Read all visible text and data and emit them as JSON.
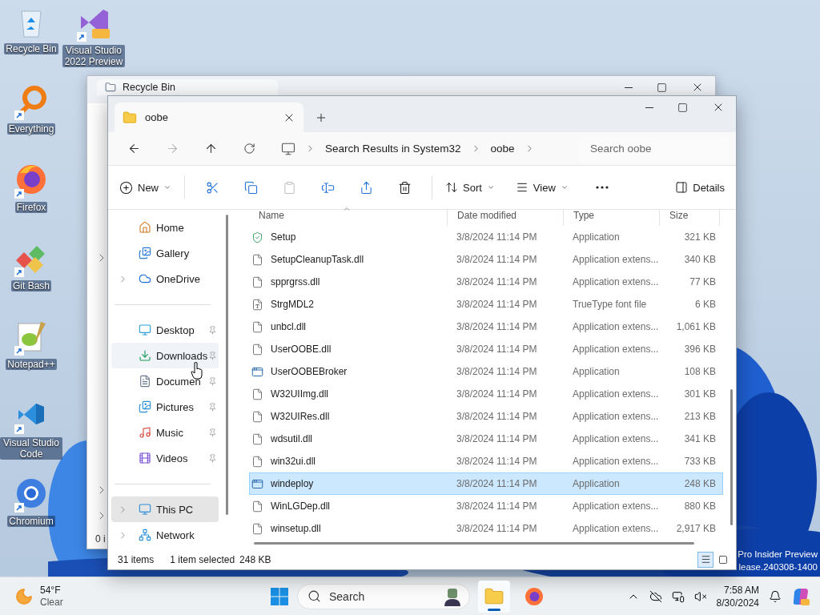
{
  "desktop": {
    "icons": [
      {
        "label": "Recycle Bin",
        "kind": "recycle",
        "shortcut": false
      },
      {
        "label": "Visual Studio 2022 Preview",
        "kind": "vs",
        "shortcut": true
      },
      {
        "label": "Everything",
        "kind": "everything",
        "shortcut": true
      },
      {
        "label": "Firefox",
        "kind": "firefox",
        "shortcut": true
      },
      {
        "label": "Git Bash",
        "kind": "git",
        "shortcut": true
      },
      {
        "label": "Notepad++",
        "kind": "notepad",
        "shortcut": true
      },
      {
        "label": "Visual Studio Code",
        "kind": "vscode",
        "shortcut": true
      },
      {
        "label": "Chromium",
        "kind": "chromium",
        "shortcut": true
      }
    ],
    "watermark": [
      "Pro Insider Preview",
      "lease.240308-1400"
    ]
  },
  "background_window": {
    "tab_title": "Recycle Bin",
    "status": "0 i"
  },
  "window": {
    "tabs": [
      {
        "title": "oobe",
        "selected": true
      }
    ],
    "address": {
      "crumbs": [
        "Search Results in System32",
        "oobe"
      ]
    },
    "search": {
      "placeholder": "Search oobe"
    },
    "toolbar": {
      "new": "New",
      "sort": "Sort",
      "view": "View",
      "details": "Details"
    },
    "nav": [
      {
        "kind": "item",
        "label": "Home",
        "expandable": false,
        "pinned": false,
        "selected": false,
        "hovered": false
      },
      {
        "kind": "item",
        "label": "Gallery",
        "expandable": false,
        "pinned": false,
        "selected": false,
        "hovered": false
      },
      {
        "kind": "item",
        "label": "OneDrive",
        "expandable": true,
        "pinned": false,
        "selected": false,
        "hovered": false
      },
      {
        "kind": "divider"
      },
      {
        "kind": "item",
        "label": "Desktop",
        "expandable": false,
        "pinned": true,
        "selected": false,
        "hovered": false
      },
      {
        "kind": "item",
        "label": "Downloads",
        "expandable": false,
        "pinned": true,
        "selected": false,
        "hovered": true
      },
      {
        "kind": "item",
        "label": "Documen",
        "expandable": false,
        "pinned": true,
        "selected": false,
        "hovered": false
      },
      {
        "kind": "item",
        "label": "Pictures",
        "expandable": false,
        "pinned": true,
        "selected": false,
        "hovered": false
      },
      {
        "kind": "item",
        "label": "Music",
        "expandable": false,
        "pinned": true,
        "selected": false,
        "hovered": false
      },
      {
        "kind": "item",
        "label": "Videos",
        "expandable": false,
        "pinned": true,
        "selected": false,
        "hovered": false
      },
      {
        "kind": "divider"
      },
      {
        "kind": "item",
        "label": "This PC",
        "expandable": true,
        "pinned": false,
        "selected": true,
        "hovered": false
      },
      {
        "kind": "item",
        "label": "Network",
        "expandable": true,
        "pinned": false,
        "selected": false,
        "hovered": false
      }
    ],
    "columns": [
      {
        "label": "Name",
        "sorted": true
      },
      {
        "label": "Date modified",
        "sorted": false
      },
      {
        "label": "Type",
        "sorted": false
      },
      {
        "label": "Size",
        "sorted": false
      }
    ],
    "rows": [
      {
        "kind": "setup",
        "name": "Setup",
        "date": "3/8/2024 11:14 PM",
        "type": "Application",
        "size": "321 KB",
        "selected": false
      },
      {
        "kind": "dll",
        "name": "SetupCleanupTask.dll",
        "date": "3/8/2024 11:14 PM",
        "type": "Application extens...",
        "size": "340 KB",
        "selected": false
      },
      {
        "kind": "dll",
        "name": "spprgrss.dll",
        "date": "3/8/2024 11:14 PM",
        "type": "Application extens...",
        "size": "77 KB",
        "selected": false
      },
      {
        "kind": "font",
        "name": "StrgMDL2",
        "date": "3/8/2024 11:14 PM",
        "type": "TrueType font file",
        "size": "6 KB",
        "selected": false
      },
      {
        "kind": "dll",
        "name": "unbcl.dll",
        "date": "3/8/2024 11:14 PM",
        "type": "Application extens...",
        "size": "1,061 KB",
        "selected": false
      },
      {
        "kind": "dll",
        "name": "UserOOBE.dll",
        "date": "3/8/2024 11:14 PM",
        "type": "Application extens...",
        "size": "396 KB",
        "selected": false
      },
      {
        "kind": "exe",
        "name": "UserOOBEBroker",
        "date": "3/8/2024 11:14 PM",
        "type": "Application",
        "size": "108 KB",
        "selected": false
      },
      {
        "kind": "dll",
        "name": "W32UIImg.dll",
        "date": "3/8/2024 11:14 PM",
        "type": "Application extens...",
        "size": "301 KB",
        "selected": false
      },
      {
        "kind": "dll",
        "name": "W32UIRes.dll",
        "date": "3/8/2024 11:14 PM",
        "type": "Application extens...",
        "size": "213 KB",
        "selected": false
      },
      {
        "kind": "dll",
        "name": "wdsutil.dll",
        "date": "3/8/2024 11:14 PM",
        "type": "Application extens...",
        "size": "341 KB",
        "selected": false
      },
      {
        "kind": "dll",
        "name": "win32ui.dll",
        "date": "3/8/2024 11:14 PM",
        "type": "Application extens...",
        "size": "733 KB",
        "selected": false
      },
      {
        "kind": "exe",
        "name": "windeploy",
        "date": "3/8/2024 11:14 PM",
        "type": "Application",
        "size": "248 KB",
        "selected": true
      },
      {
        "kind": "dll",
        "name": "WinLGDep.dll",
        "date": "3/8/2024 11:14 PM",
        "type": "Application extens...",
        "size": "880 KB",
        "selected": false
      },
      {
        "kind": "dll",
        "name": "winsetup.dll",
        "date": "3/8/2024 11:14 PM",
        "type": "Application extens...",
        "size": "2,917 KB",
        "selected": false
      }
    ],
    "status": {
      "count": "31 items",
      "selection": "1 item selected",
      "size": "248 KB"
    },
    "views": [
      {
        "kind": "details",
        "selected": true
      },
      {
        "kind": "tiles",
        "selected": false
      }
    ]
  },
  "taskbar": {
    "weather": {
      "temp": "54°F",
      "condition": "Clear"
    },
    "search": "Search",
    "apps": [
      {
        "kind": "explorer",
        "active": true
      },
      {
        "kind": "firefox",
        "active": false
      }
    ],
    "time": "7:58 AM",
    "date": "8/30/2024"
  }
}
